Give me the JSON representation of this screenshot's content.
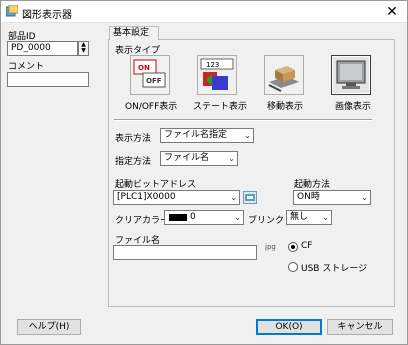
{
  "window": {
    "title": "図形表示器"
  },
  "left": {
    "part_id_label": "部品ID",
    "part_id_value": "PD_0000",
    "comment_label": "コメント",
    "comment_value": ""
  },
  "tabs": [
    {
      "label": "基本設定"
    }
  ],
  "display_type": {
    "label": "表示タイプ",
    "options": [
      {
        "label": "ON/OFF表示",
        "icon": "onoff-display-icon",
        "selected": false
      },
      {
        "label": "ステート表示",
        "icon": "state-display-icon",
        "selected": false
      },
      {
        "label": "移動表示",
        "icon": "move-display-icon",
        "selected": false
      },
      {
        "label": "画像表示",
        "icon": "image-display-icon",
        "selected": true
      }
    ],
    "onoff_icon_text": {
      "on": "ON",
      "off": "OFF"
    },
    "state_icon_text": "123"
  },
  "display_method": {
    "label": "表示方法",
    "value": "ファイル名指定"
  },
  "specify_method": {
    "label": "指定方法",
    "value": "ファイル名"
  },
  "trigger_bit": {
    "label": "起動ビットアドレス",
    "value": "[PLC1]X0000"
  },
  "trigger_mode": {
    "label": "起動方法",
    "value": "ON時"
  },
  "clear_color": {
    "label": "クリアカラー",
    "value": "0",
    "swatch": "#000000"
  },
  "blink": {
    "label": "ブリンク",
    "value": "無し"
  },
  "file_name": {
    "label": "ファイル名",
    "value": "",
    "ext": "jpg"
  },
  "storage": {
    "options": [
      {
        "label": "CF",
        "selected": true
      },
      {
        "label": "USB ストレージ",
        "selected": false
      }
    ]
  },
  "buttons": {
    "help": "ヘルプ(H)",
    "ok": "OK(O)",
    "cancel": "キャンセル"
  },
  "colors": {
    "accent": "#0078d7",
    "background": "#f0f0f0"
  }
}
